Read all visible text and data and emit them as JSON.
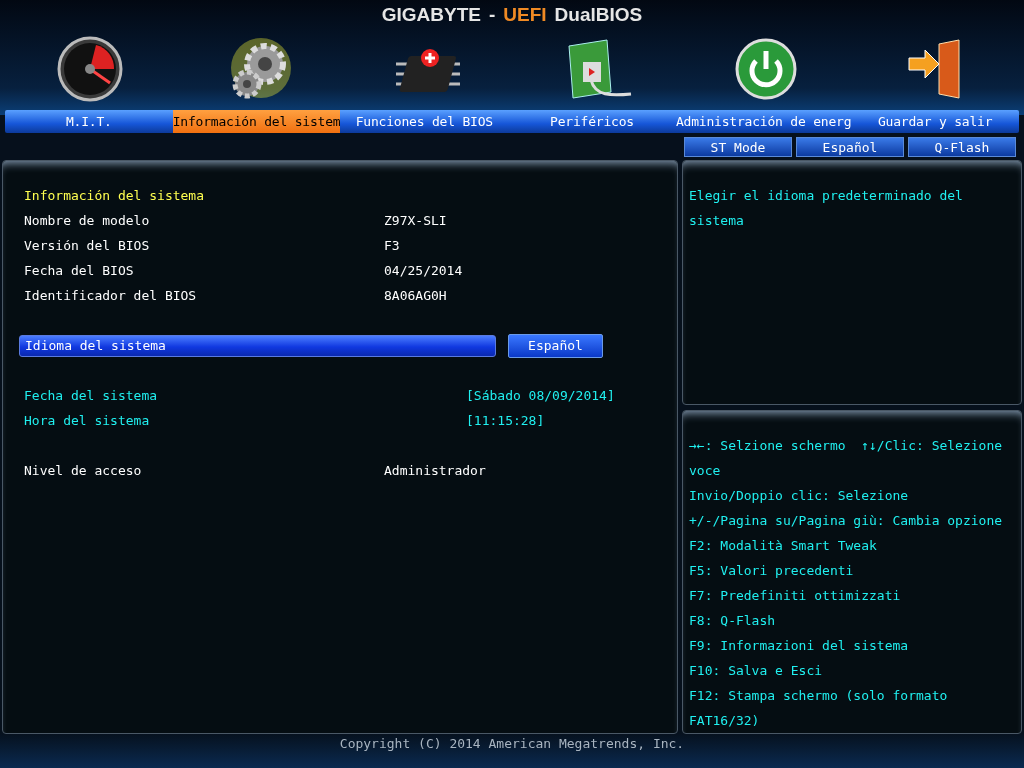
{
  "header": {
    "brand": "GIGABYTE",
    "separator": "-",
    "accent": "UEFI",
    "product": "DualBIOS"
  },
  "tabs": [
    {
      "kind": "gauge",
      "label": "M.I.T.",
      "selected": false
    },
    {
      "kind": "gears",
      "label": "Información del sistem",
      "selected": true
    },
    {
      "kind": "chip",
      "label": "Funciones del BIOS",
      "selected": false
    },
    {
      "kind": "board",
      "label": "Periféricos",
      "selected": false
    },
    {
      "kind": "power",
      "label": "Administración de energ",
      "selected": false
    },
    {
      "kind": "exit",
      "label": "Guardar y salir",
      "selected": false
    }
  ],
  "quick_buttons": [
    "ST Mode",
    "Español",
    "Q-Flash"
  ],
  "main": {
    "groups": [
      {
        "items": [
          {
            "kind": "heading",
            "label": "Información del sistema"
          },
          {
            "kind": "info",
            "label": "Nombre de modelo",
            "value": "Z97X-SLI"
          },
          {
            "kind": "info",
            "label": "Versión del BIOS",
            "value": "F3"
          },
          {
            "kind": "info",
            "label": "Fecha del BIOS",
            "value": "04/25/2014"
          },
          {
            "kind": "info",
            "label": "Identificador del BIOS",
            "value": "8A06AG0H"
          }
        ]
      },
      {
        "items": [
          {
            "kind": "option",
            "label": "Idioma del sistema",
            "value": "Español",
            "selected": true
          }
        ]
      },
      {
        "items": [
          {
            "kind": "editable",
            "label": "Fecha del sistema",
            "value": "[Sábado 08/09/2014]"
          },
          {
            "kind": "editable",
            "label": "Hora del sistema",
            "value": "[11:15:28]"
          }
        ]
      },
      {
        "items": [
          {
            "kind": "info",
            "label": "Nivel de acceso",
            "value": "Administrador"
          }
        ]
      }
    ]
  },
  "description": "Elegir el idioma predeterminado del sistema",
  "help": [
    "→←: Selzione schermo  ↑↓/Clic: Selezione voce",
    "Invio/Doppio clic: Selezione",
    "+/-/Pagina su/Pagina giù: Cambia opzione",
    "F2: Modalità Smart Tweak",
    "F5: Valori precedenti",
    "F7: Predefiniti ottimizzati",
    "F8: Q-Flash",
    "F9: Informazioni del sistema",
    "F10: Salva e Esci",
    "F12: Stampa schermo (solo formato FAT16/32)"
  ],
  "footer": "Copyright (C) 2014 American Megatrends, Inc."
}
